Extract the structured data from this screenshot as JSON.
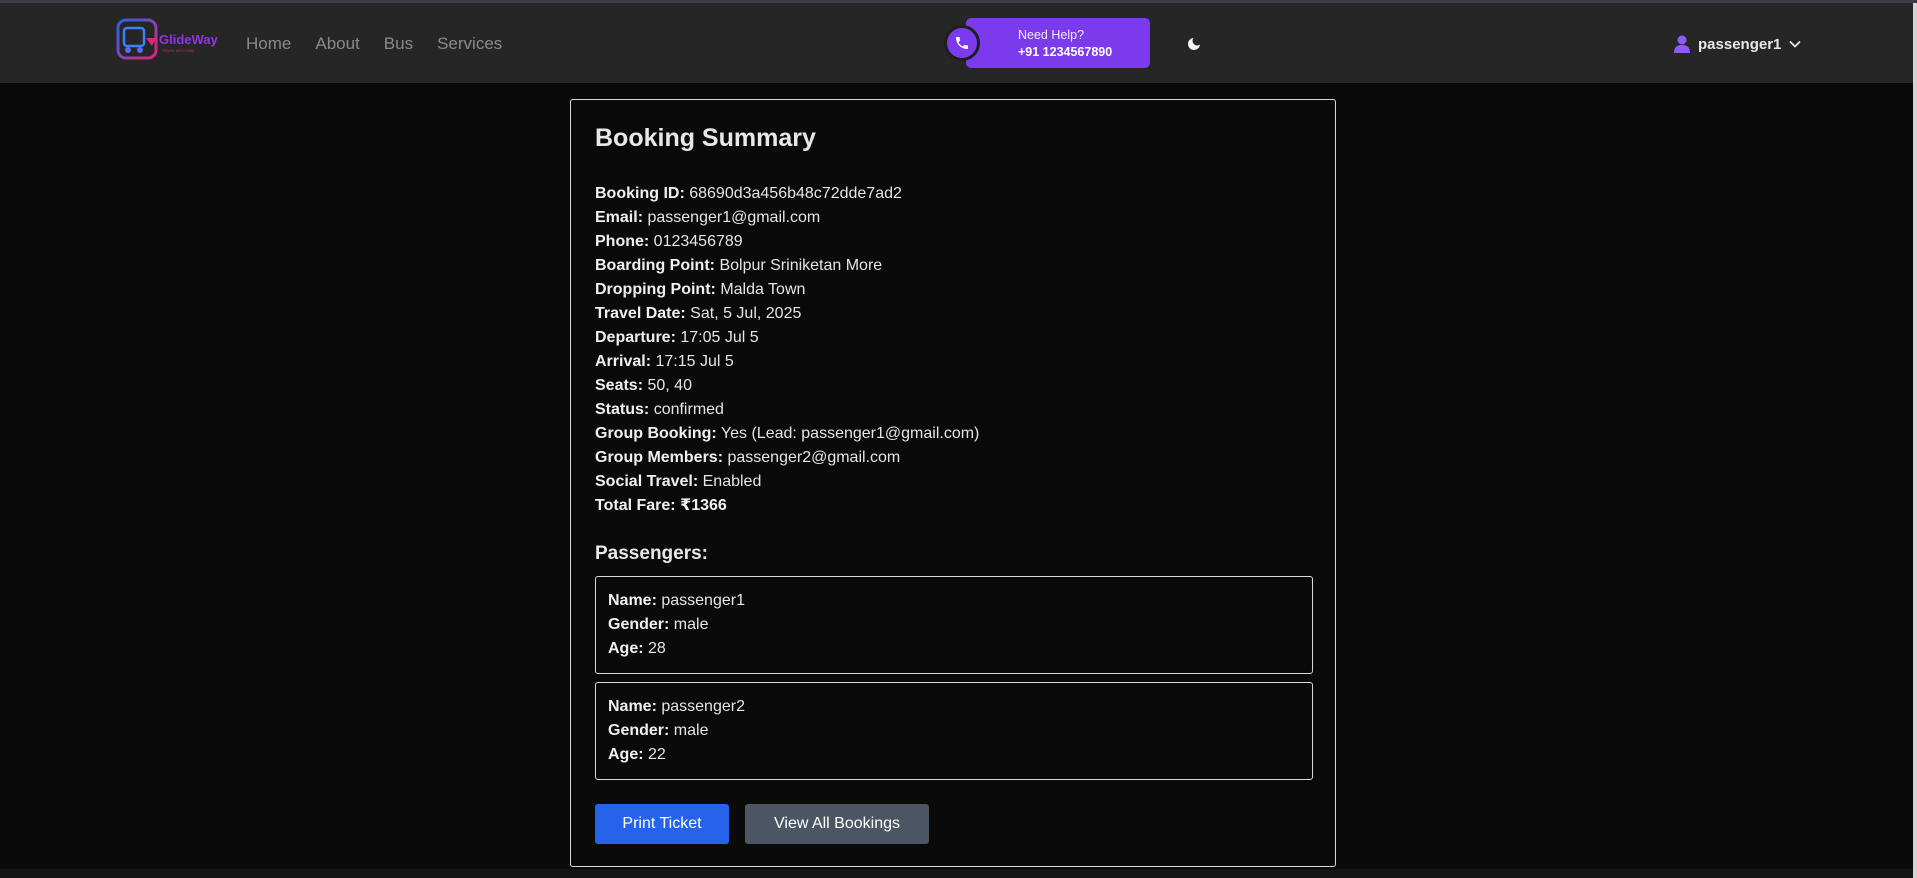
{
  "navbar": {
    "logo_text": "GlideWay",
    "logo_tagline": "TRAVEL WITH EASE",
    "links": [
      "Home",
      "About",
      "Bus",
      "Services"
    ],
    "help_title": "Need Help?",
    "help_phone": "+91 1234567890",
    "user_name": "passenger1",
    "accent_color": "#7c3aed"
  },
  "booking": {
    "title": "Booking Summary",
    "fields": [
      {
        "label": "Booking ID:",
        "value": "68690d3a456b48c72dde7ad2"
      },
      {
        "label": "Email:",
        "value": "passenger1@gmail.com"
      },
      {
        "label": "Phone:",
        "value": "0123456789"
      },
      {
        "label": "Boarding Point:",
        "value": "Bolpur Sriniketan More"
      },
      {
        "label": "Dropping Point:",
        "value": "Malda Town"
      },
      {
        "label": "Travel Date:",
        "value": "Sat, 5 Jul, 2025"
      },
      {
        "label": "Departure:",
        "value": "17:05 Jul 5"
      },
      {
        "label": "Arrival:",
        "value": "17:15 Jul 5"
      },
      {
        "label": "Seats:",
        "value": "50, 40"
      },
      {
        "label": "Status:",
        "value": "confirmed"
      },
      {
        "label": "Group Booking:",
        "value": "Yes (Lead: passenger1@gmail.com)"
      },
      {
        "label": "Group Members:",
        "value": "passenger2@gmail.com"
      },
      {
        "label": "Social Travel:",
        "value": "Enabled"
      }
    ],
    "total_fare_label": "Total Fare:",
    "total_fare_value": "₹1366"
  },
  "passengers": {
    "heading": "Passengers:",
    "name_label": "Name:",
    "gender_label": "Gender:",
    "age_label": "Age:",
    "list": [
      {
        "name": "passenger1",
        "gender": "male",
        "age": "28"
      },
      {
        "name": "passenger2",
        "gender": "male",
        "age": "22"
      }
    ]
  },
  "actions": {
    "print_label": "Print Ticket",
    "view_all_label": "View All Bookings"
  },
  "icons": {
    "phone": "phone-icon",
    "theme": "moon-icon",
    "user": "user-icon",
    "dropdown": "chevron-down-icon"
  }
}
